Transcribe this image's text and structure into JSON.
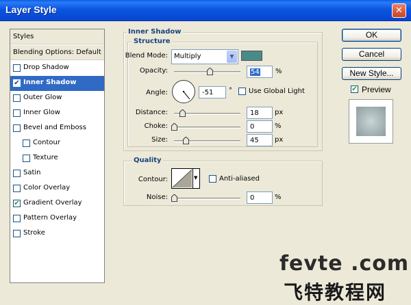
{
  "window": {
    "title": "Layer Style",
    "close_glyph": "✕"
  },
  "styles_list": {
    "header": "Styles",
    "blending": "Blending Options: Default",
    "items": [
      {
        "label": "Drop Shadow",
        "checked": false,
        "selected": false,
        "indent": false
      },
      {
        "label": "Inner Shadow",
        "checked": true,
        "selected": true,
        "indent": false
      },
      {
        "label": "Outer Glow",
        "checked": false,
        "selected": false,
        "indent": false
      },
      {
        "label": "Inner Glow",
        "checked": false,
        "selected": false,
        "indent": false
      },
      {
        "label": "Bevel and Emboss",
        "checked": false,
        "selected": false,
        "indent": false
      },
      {
        "label": "Contour",
        "checked": false,
        "selected": false,
        "indent": true
      },
      {
        "label": "Texture",
        "checked": false,
        "selected": false,
        "indent": true
      },
      {
        "label": "Satin",
        "checked": false,
        "selected": false,
        "indent": false
      },
      {
        "label": "Color Overlay",
        "checked": false,
        "selected": false,
        "indent": false
      },
      {
        "label": "Gradient Overlay",
        "checked": true,
        "selected": false,
        "indent": false
      },
      {
        "label": "Pattern Overlay",
        "checked": false,
        "selected": false,
        "indent": false
      },
      {
        "label": "Stroke",
        "checked": false,
        "selected": false,
        "indent": false
      }
    ]
  },
  "inner_shadow": {
    "title": "Inner Shadow",
    "structure": {
      "title": "Structure",
      "blend_mode_label": "Blend Mode:",
      "blend_mode_value": "Multiply",
      "shadow_color": "#4a8a8a",
      "opacity_label": "Opacity:",
      "opacity_value": "54",
      "opacity_unit": "%",
      "opacity_fraction": 0.54,
      "angle_label": "Angle:",
      "angle_value": "-51",
      "angle_unit": "°",
      "angle_degrees": -51,
      "global_light_label": "Use Global Light",
      "global_light_checked": false,
      "distance_label": "Distance:",
      "distance_value": "18",
      "distance_unit": "px",
      "distance_fraction": 0.12,
      "choke_label": "Choke:",
      "choke_value": "0",
      "choke_unit": "%",
      "choke_fraction": 0,
      "size_label": "Size:",
      "size_value": "45",
      "size_unit": "px",
      "size_fraction": 0.18
    },
    "quality": {
      "title": "Quality",
      "contour_label": "Contour:",
      "anti_aliased_label": "Anti-aliased",
      "anti_aliased_checked": false,
      "noise_label": "Noise:",
      "noise_value": "0",
      "noise_unit": "%",
      "noise_fraction": 0
    }
  },
  "buttons": {
    "ok": "OK",
    "cancel": "Cancel",
    "new_style": "New Style...",
    "preview_label": "Preview",
    "preview_checked": true
  },
  "watermark": {
    "line1": "fevte .com",
    "line2": "飞特教程网"
  }
}
